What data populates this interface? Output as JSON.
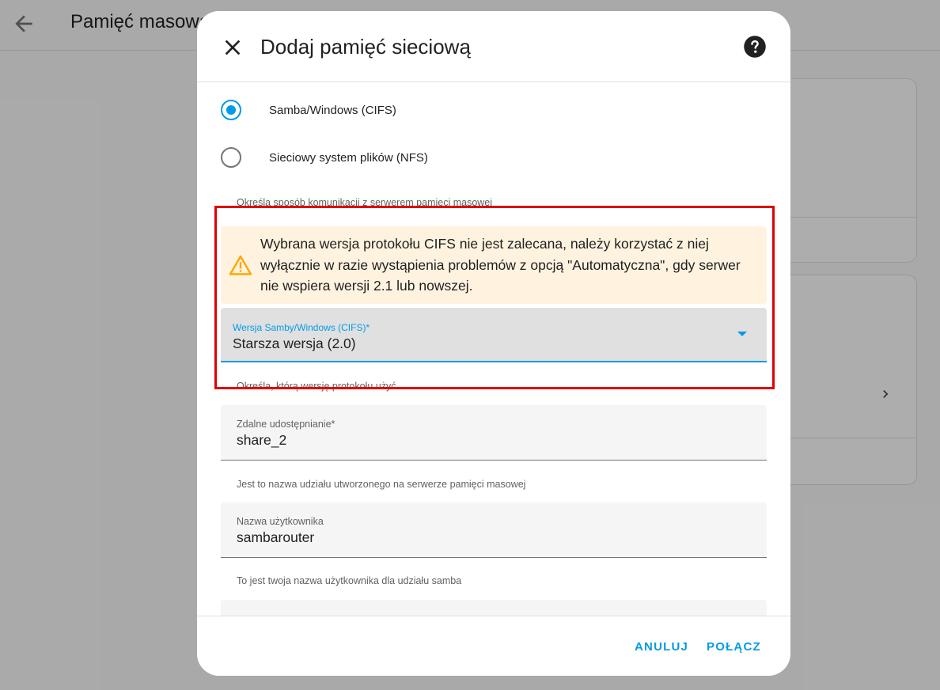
{
  "background": {
    "page_title": "Pamięć masowa"
  },
  "dialog": {
    "title": "Dodaj pamięć sieciową",
    "protocol": {
      "options": [
        {
          "label": "Samba/Windows (CIFS)",
          "checked": true
        },
        {
          "label": "Sieciowy system plików (NFS)",
          "checked": false
        }
      ],
      "helper": "Określa sposób komunikacji z serwerem pamięci masowej"
    },
    "alert": {
      "text": "Wybrana wersja protokołu CIFS nie jest zalecana, należy korzystać z niej wyłącznie w razie wystąpienia problemów z opcją \"Automatyczna\", gdy serwer nie wspiera wersji 2.1 lub nowszej."
    },
    "cifs_version": {
      "label": "Wersja Samby/Windows (CIFS)*",
      "value": "Starsza wersja (2.0)",
      "helper": "Określa, którą wersję protokołu użyć"
    },
    "remote_share": {
      "label": "Zdalne udostępnianie*",
      "value": "share_2",
      "helper": "Jest to nazwa udziału utworzonego na serwerze pamięci masowej"
    },
    "username": {
      "label": "Nazwa użytkownika",
      "value": "sambarouter",
      "helper": "To jest twoja nazwa użytkownika dla udziału samba"
    },
    "buttons": {
      "cancel": "ANULUJ",
      "connect": "POŁĄCZ"
    }
  },
  "colors": {
    "accent": "#039be5",
    "warning": "#ffa600",
    "alert_background": "#fff3e0",
    "highlight": "#e00000"
  }
}
